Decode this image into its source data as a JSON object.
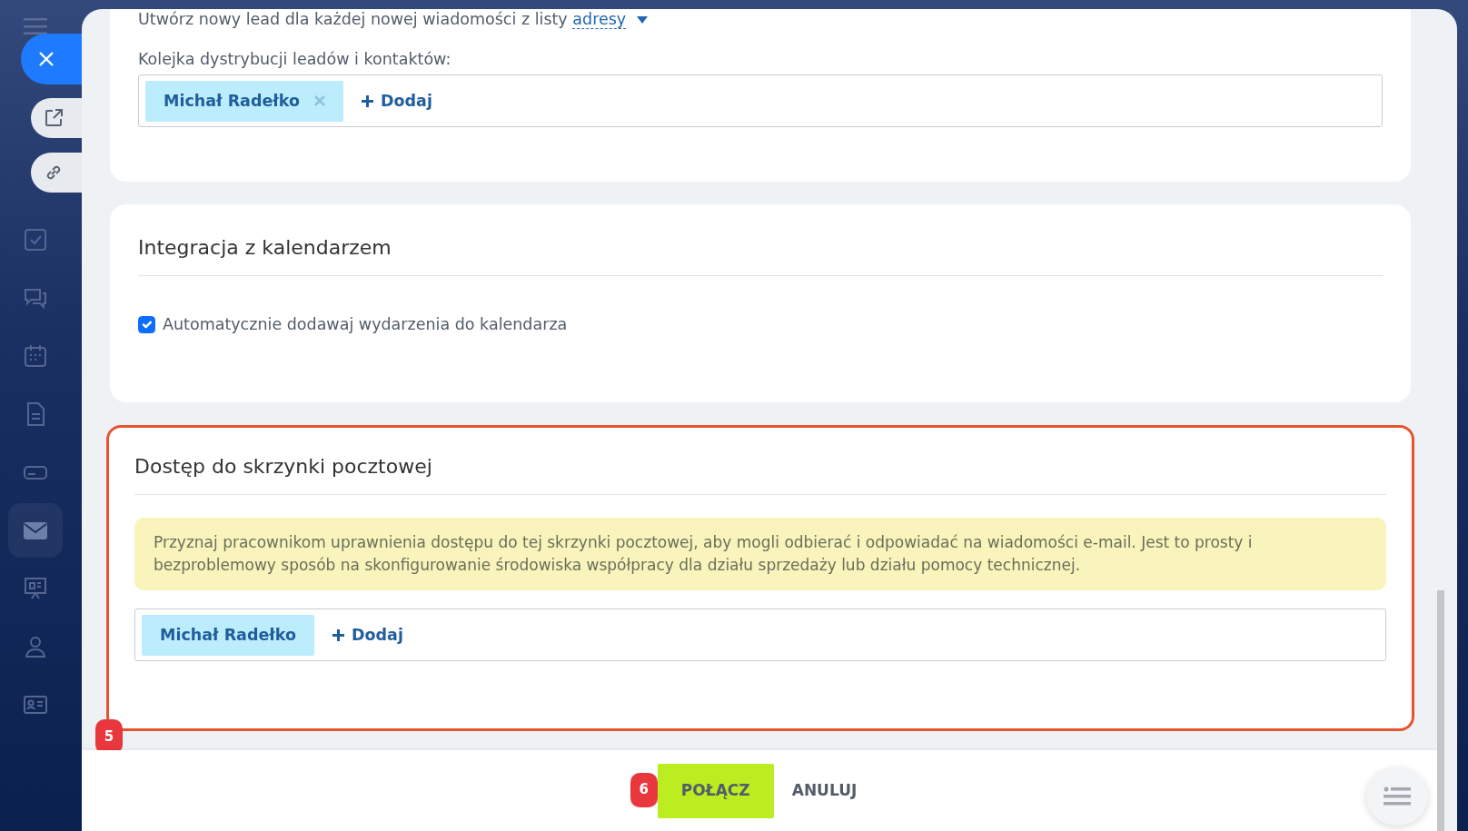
{
  "sidebar": {
    "items": [
      {
        "kind": "tasks",
        "selected": false
      },
      {
        "kind": "chat",
        "selected": false
      },
      {
        "kind": "calendar",
        "selected": false
      },
      {
        "kind": "document",
        "selected": false
      },
      {
        "kind": "drive",
        "selected": false
      },
      {
        "kind": "mail",
        "selected": true
      },
      {
        "kind": "board",
        "selected": false
      },
      {
        "kind": "people",
        "selected": false
      },
      {
        "kind": "card",
        "selected": false
      }
    ]
  },
  "lead_option": {
    "text": "Utwórz nowy lead dla każdej nowej wiadomości z listy",
    "link": "adresy"
  },
  "queue": {
    "label": "Kolejka dystrybucji leadów i kontaktów:",
    "tags": [
      {
        "name": "Michał Radełko",
        "removable": true
      }
    ],
    "add": "Dodaj"
  },
  "calendar_section": {
    "title": "Integracja z kalendarzem",
    "options": [
      {
        "label": "Automatycznie dodawaj wydarzenia do kalendarza",
        "checked": true
      }
    ]
  },
  "access_section": {
    "title": "Dostęp do skrzynki pocztowej",
    "highlighted": true,
    "badge": "5",
    "info": "Przyznaj pracownikom uprawnienia dostępu do tej skrzynki pocztowej, aby mogli odbierać i odpowiadać na wiadomości e-mail. Jest to prosty i bezproblemowy sposób na skonfigurowanie środowiska współpracy dla działu sprzedaży lub działu pomocy technicznej.",
    "tags": [
      {
        "name": "Michał Radełko",
        "removable": false
      }
    ],
    "add": "Dodaj"
  },
  "footer": {
    "buttons": [
      {
        "label": "POŁĄCZ",
        "kind": "primary",
        "badge": "6"
      },
      {
        "label": "ANULUJ",
        "kind": "link"
      }
    ]
  }
}
